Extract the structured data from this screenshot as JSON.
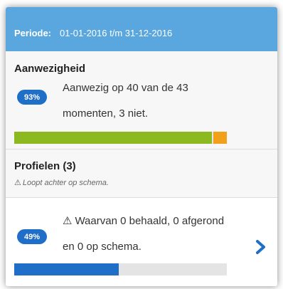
{
  "header": {
    "label": "Periode:",
    "value": "01-01-2016 t/m 31-12-2016"
  },
  "attendance": {
    "title": "Aanwezigheid",
    "badge": "93%",
    "line1": "Aanwezig op 40 van de 43",
    "line2": "momenten, 3 niet.",
    "present_count": 40,
    "absent_count": 3,
    "total": 43,
    "colors": {
      "present": "#8cb820",
      "absent": "#f2a01a"
    }
  },
  "profiles": {
    "title": "Profielen (3)",
    "note_icon": "warning-icon",
    "note": "Loopt achter op schema."
  },
  "progress": {
    "badge": "49%",
    "warn_icon": "warning-icon",
    "line1": "Waarvan 0 behaald, 0 afgerond",
    "line2": "en 0 op schema.",
    "fraction": 0.49,
    "color": "#1f6ec7",
    "chevron_icon": "chevron-right-icon"
  }
}
